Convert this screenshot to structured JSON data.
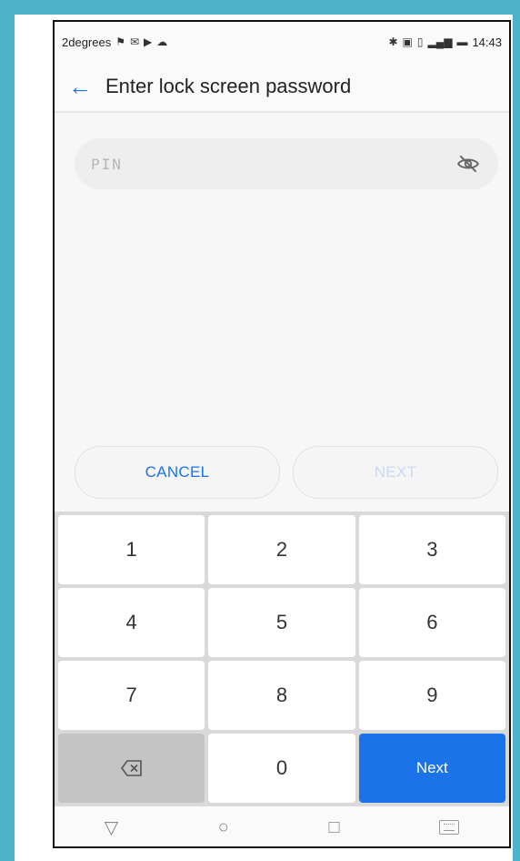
{
  "status_bar": {
    "carrier": "2degrees",
    "left_icons": [
      "notification-icon",
      "message-icon",
      "play-icon",
      "cloud-icon"
    ],
    "right_icons": [
      "bluetooth-icon",
      "nfc-icon",
      "vibrate-icon",
      "signal-icon",
      "battery-icon"
    ],
    "time": "14:43"
  },
  "app_bar": {
    "back_icon": "arrow-left-icon",
    "title": "Enter lock screen password"
  },
  "pin_field": {
    "placeholder": "PIN",
    "value": "",
    "visibility_icon": "eye-off-icon"
  },
  "actions": {
    "cancel_label": "CANCEL",
    "next_label": "NEXT"
  },
  "keypad": {
    "keys": [
      "1",
      "2",
      "3",
      "4",
      "5",
      "6",
      "7",
      "8",
      "9"
    ],
    "zero": "0",
    "delete_icon": "backspace-icon",
    "next_label": "Next"
  },
  "nav_bar": {
    "icons": [
      "back-triangle-icon",
      "home-circle-icon",
      "recents-square-icon",
      "keyboard-icon"
    ]
  },
  "colors": {
    "accent": "#1a73e8",
    "frame_bg": "#4bb2c9"
  }
}
